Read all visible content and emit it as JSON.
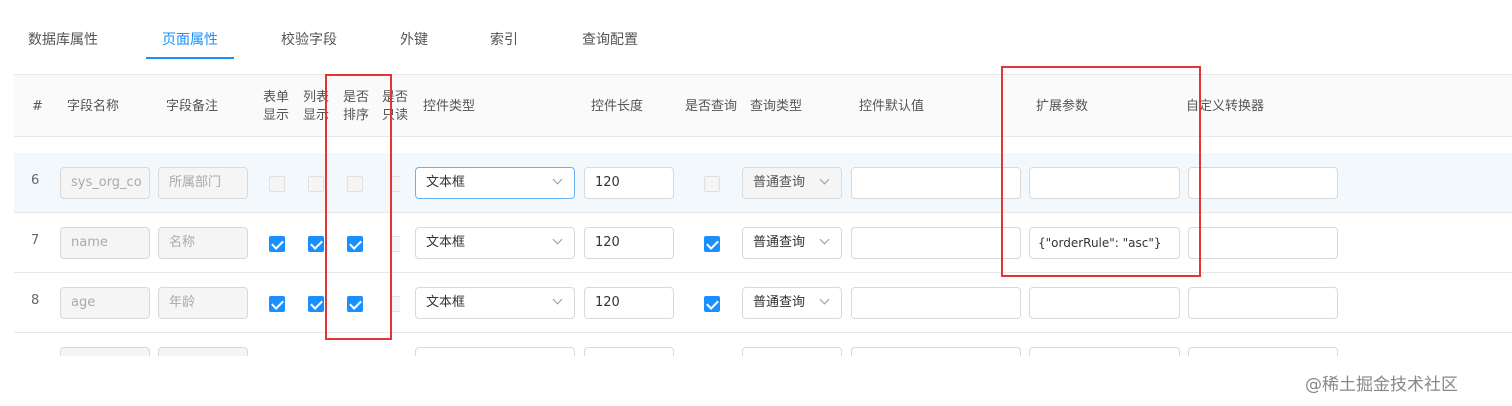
{
  "tabs": [
    {
      "label": "数据库属性",
      "active": false
    },
    {
      "label": "页面属性",
      "active": true
    },
    {
      "label": "校验字段",
      "active": false
    },
    {
      "label": "外键",
      "active": false
    },
    {
      "label": "索引",
      "active": false
    },
    {
      "label": "查询配置",
      "active": false
    }
  ],
  "header": {
    "index": "#",
    "field_name": "字段名称",
    "field_note": "字段备注",
    "form_show_1": "表单",
    "form_show_2": "显示",
    "list_show_1": "列表",
    "list_show_2": "显示",
    "sortable_1": "是否",
    "sortable_2": "排序",
    "readonly_1": "是否",
    "readonly_2": "只读",
    "control_type": "控件类型",
    "control_length": "控件长度",
    "is_query": "是否查询",
    "query_type": "查询类型",
    "control_default": "控件默认值",
    "ext_params": "扩展参数",
    "custom_converter": "自定义转换器"
  },
  "rows": [
    {
      "no": "6",
      "field_name": "sys_org_co",
      "field_note": "所属部门",
      "form_show": false,
      "list_show": false,
      "sortable": false,
      "readonly": false,
      "control_type": "文本框",
      "control_length": "120",
      "is_query": false,
      "query_type": "普通查询",
      "control_default": "",
      "ext_params": "",
      "custom_converter": ""
    },
    {
      "no": "7",
      "field_name": "name",
      "field_note": "名称",
      "form_show": true,
      "list_show": true,
      "sortable": true,
      "readonly": false,
      "control_type": "文本框",
      "control_length": "120",
      "is_query": true,
      "query_type": "普通查询",
      "control_default": "",
      "ext_params": "{\"orderRule\": \"asc\"}",
      "custom_converter": ""
    },
    {
      "no": "8",
      "field_name": "age",
      "field_note": "年龄",
      "form_show": true,
      "list_show": true,
      "sortable": true,
      "readonly": false,
      "control_type": "文本框",
      "control_length": "120",
      "is_query": true,
      "query_type": "普通查询",
      "control_default": "",
      "ext_params": "",
      "custom_converter": ""
    }
  ],
  "highlight_color": "#e23636",
  "accent_color": "#1890ff",
  "watermark": "@稀土掘金技术社区"
}
